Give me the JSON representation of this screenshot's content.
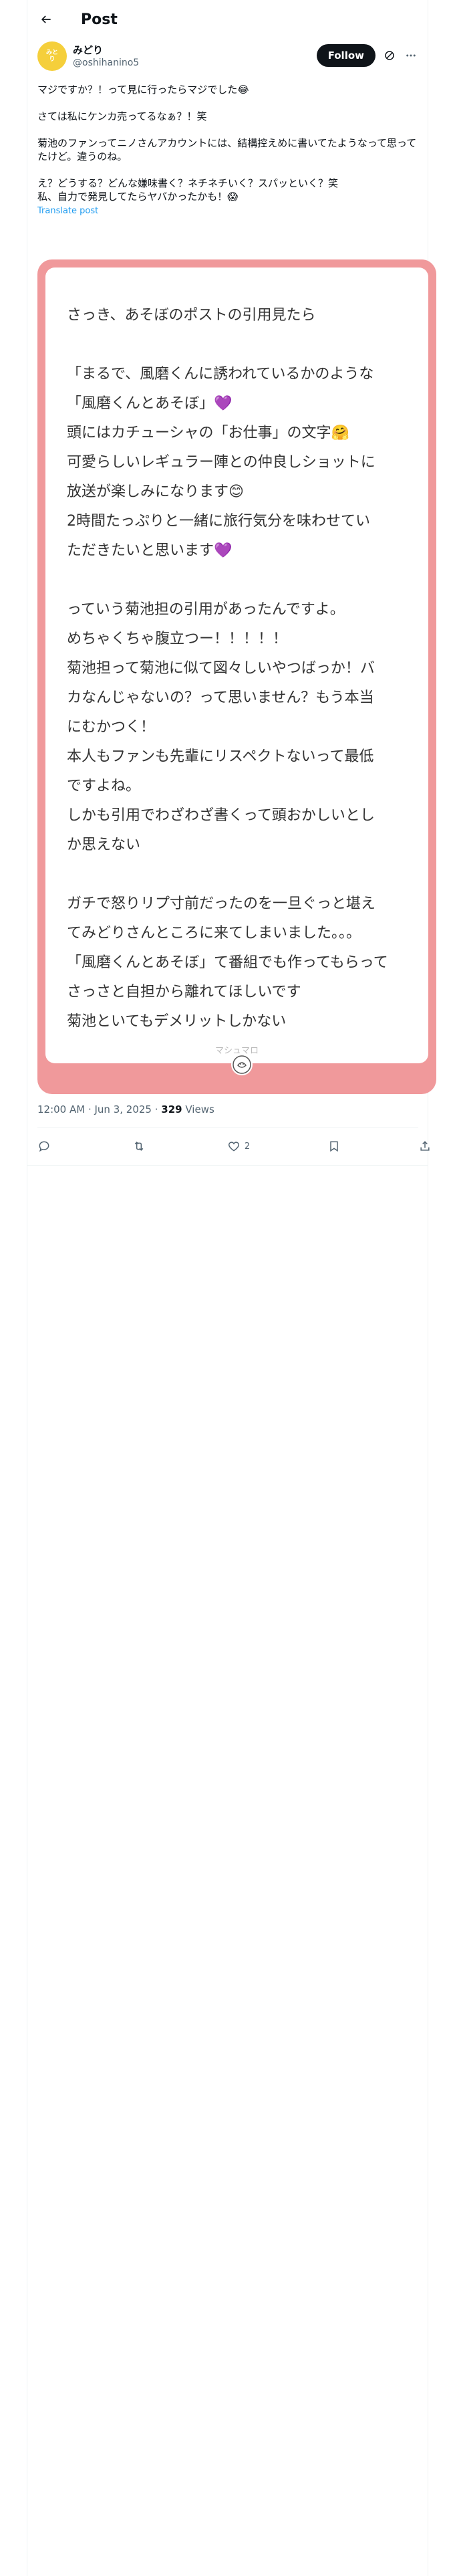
{
  "header": {
    "title": "Post"
  },
  "tweet": {
    "avatar_text": "みと\nり",
    "display_name": "みどり",
    "handle": "@oshihanino5",
    "follow_label": "Follow",
    "body": [
      "マジですか？！って見に行ったらマジでした😂",
      "",
      "さては私にケンカ売ってるなぁ？！笑",
      "",
      "菊池のファンってニノさんアカウントには、結構控えめに書いてたようなって思ってたけど。違うのね。",
      "",
      "え？どうする？どんな嫌味書く？ネチネチいく？スパッといく？笑",
      "私、自力で発見してたらヤバかったかも！😱"
    ],
    "translate_label": "Translate post"
  },
  "card": {
    "lines": [
      "さっき、あそぼのポストの引用見たら",
      "",
      "「まるで、風磨くんに誘われているかのような",
      "「風磨くんとあそぼ」💜",
      "頭にはカチューシャの「お仕事」の文字🤗",
      "可愛らしいレギュラー陣との仲良しショットに",
      "放送が楽しみになります😊",
      "2時間たっぷりと一緒に旅行気分を味わせてい",
      "ただきたいと思います💜",
      "",
      "っていう菊池担の引用があったんですよ。",
      "めちゃくちゃ腹立つー！！！！！",
      "菊池担って菊池に似て図々しいやつばっか！バ",
      "カなんじゃないの？って思いません？もう本当",
      "にむかつく！",
      "本人もファンも先輩にリスペクトないって最低",
      "ですよね。",
      "しかも引用でわざわざ書くって頭おかしいとし",
      "か思えない",
      "",
      "ガチで怒りリプ寸前だったのを一旦ぐっと堪え",
      "てみどりさんところに来てしまいました。。。",
      "「風磨くんとあそぼ」て番組でも作ってもらって",
      "さっさと自担から離れてほしいです",
      "菊池といてもデメリットしかない"
    ],
    "footer": "マシュマロ"
  },
  "meta": {
    "time": "12:00 AM · Jun 3, 2025 · ",
    "views_count": "329",
    "views_label": " Views"
  },
  "actions": {
    "reply_count": "",
    "repost_count": "",
    "like_count": "2"
  }
}
